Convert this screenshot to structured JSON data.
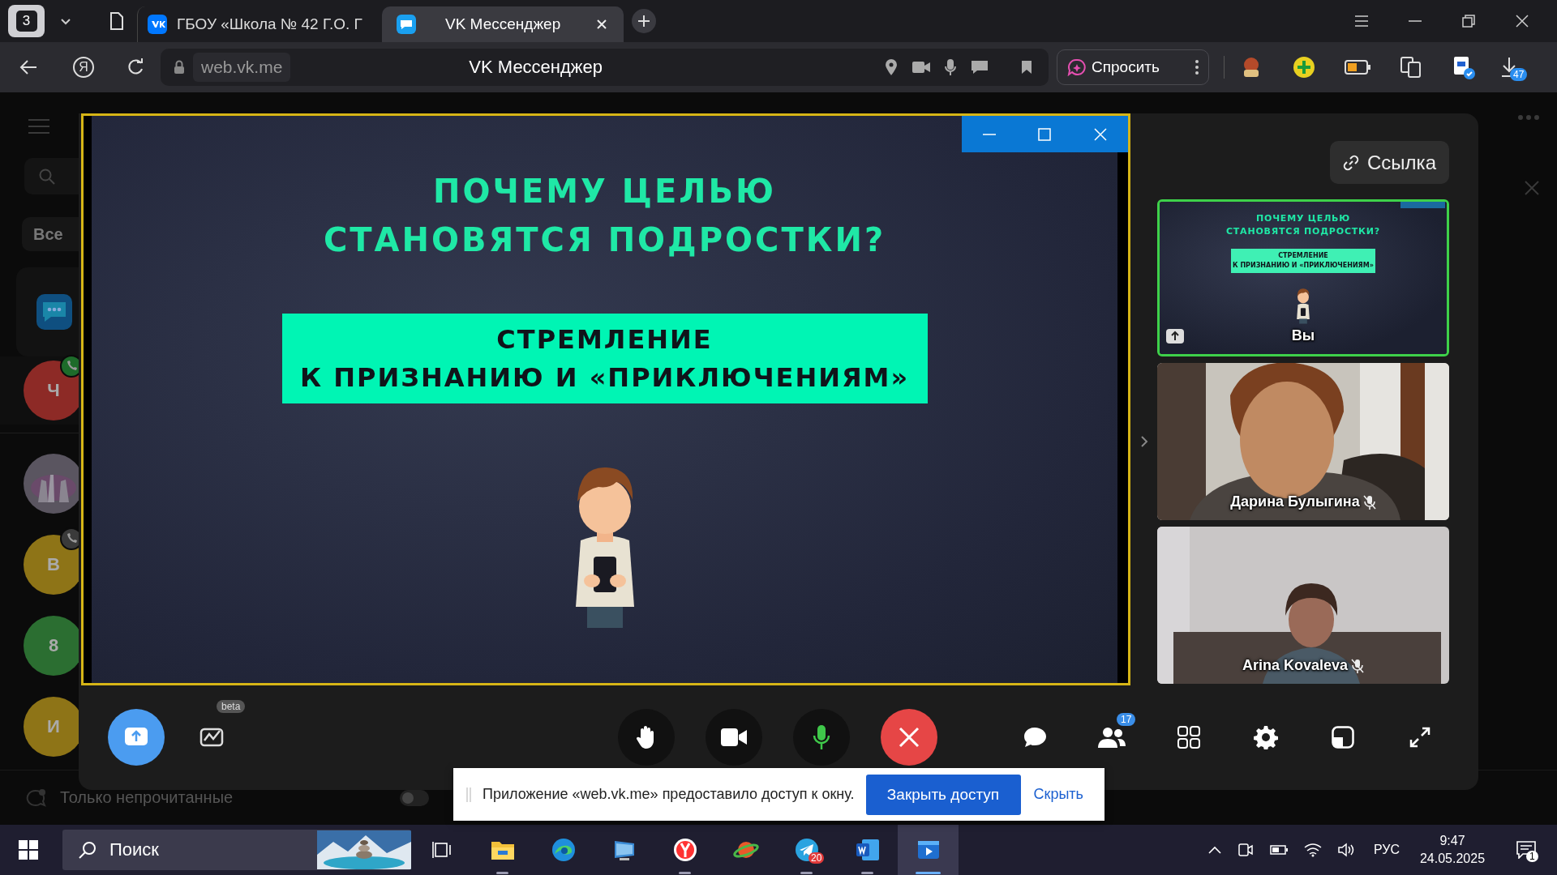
{
  "browser": {
    "tab_count": "3",
    "tabs": [
      {
        "kind": "vk",
        "title": "ГБОУ «Школа № 42 Г.О. Г",
        "selected": false
      },
      {
        "kind": "messenger",
        "title": "VK Мессенджер",
        "selected": true
      }
    ],
    "home_button": "Я",
    "address": "web.vk.me",
    "page_title": "VK Мессенджер",
    "ask_button": "Спросить",
    "downloads_badge": "47"
  },
  "sidebar": {
    "filter_chip": "Все",
    "chats": [
      {
        "kind": "app",
        "selected": false
      },
      {
        "kind": "letter",
        "initial": "Ч",
        "color": "#8d2a26",
        "call": true,
        "call_active": true,
        "selected": true
      },
      {
        "kind": "picture",
        "selected": false
      },
      {
        "kind": "letter",
        "initial": "В",
        "color": "#8e7417",
        "call": true,
        "call_active": false,
        "selected": false
      },
      {
        "kind": "letter",
        "initial": "8",
        "color": "#2b6e31",
        "selected": false
      },
      {
        "kind": "letter",
        "initial": "И",
        "color": "#8e7417",
        "selected": false
      }
    ],
    "unread_filter": "Только непрочитанные",
    "unread_only": false
  },
  "call": {
    "slide": {
      "title_lines": [
        "ПОЧЕМУ ЦЕЛЬЮ",
        "СТАНОВЯТСЯ ПОДРОСТКИ?"
      ],
      "box_lines": [
        "СТРЕМЛЕНИЕ",
        "К ПРИЗНАНИЮ И «ПРИКЛЮЧЕНИЯМ»"
      ]
    },
    "link_button": "Ссылка",
    "participants": [
      {
        "kind": "screen",
        "name": "Вы",
        "selected": true,
        "muted": false,
        "slide": {
          "title_lines": [
            "ПОЧЕМУ ЦЕЛЬЮ",
            "СТАНОВЯТСЯ ПОДРОСТКИ?"
          ],
          "box_lines": [
            "СТРЕМЛЕНИЕ",
            "К ПРИЗНАНИЮ И «ПРИКЛЮЧЕНИЯМ»"
          ]
        }
      },
      {
        "kind": "video",
        "name": "Дарина Булыгина",
        "selected": false,
        "muted": true
      },
      {
        "kind": "video",
        "name": "Arina Kovaleva",
        "selected": false,
        "muted": true
      }
    ],
    "whiteboard_badge": "beta",
    "participants_count": "17",
    "mic_on": true
  },
  "share_notice": {
    "text": "Приложение «web.vk.me» предоставило доступ к окну.",
    "stop_button": "Закрыть доступ",
    "hide_link": "Скрыть"
  },
  "taskbar": {
    "search_placeholder": "Поиск",
    "apps": [
      {
        "kind": "taskview",
        "running": false,
        "selected": false
      },
      {
        "kind": "explorer",
        "running": true,
        "selected": false
      },
      {
        "kind": "edge",
        "running": false,
        "selected": false
      },
      {
        "kind": "monitor",
        "running": false,
        "selected": false
      },
      {
        "kind": "yandex",
        "running": true,
        "selected": false
      },
      {
        "kind": "planet",
        "running": false,
        "selected": false
      },
      {
        "kind": "telegram",
        "running": true,
        "selected": false,
        "badge": "20"
      },
      {
        "kind": "word",
        "running": true,
        "selected": false
      },
      {
        "kind": "player",
        "running": true,
        "selected": true
      }
    ],
    "language": "РУС",
    "time": "9:47",
    "date": "24.05.2025",
    "notifications": "1"
  }
}
